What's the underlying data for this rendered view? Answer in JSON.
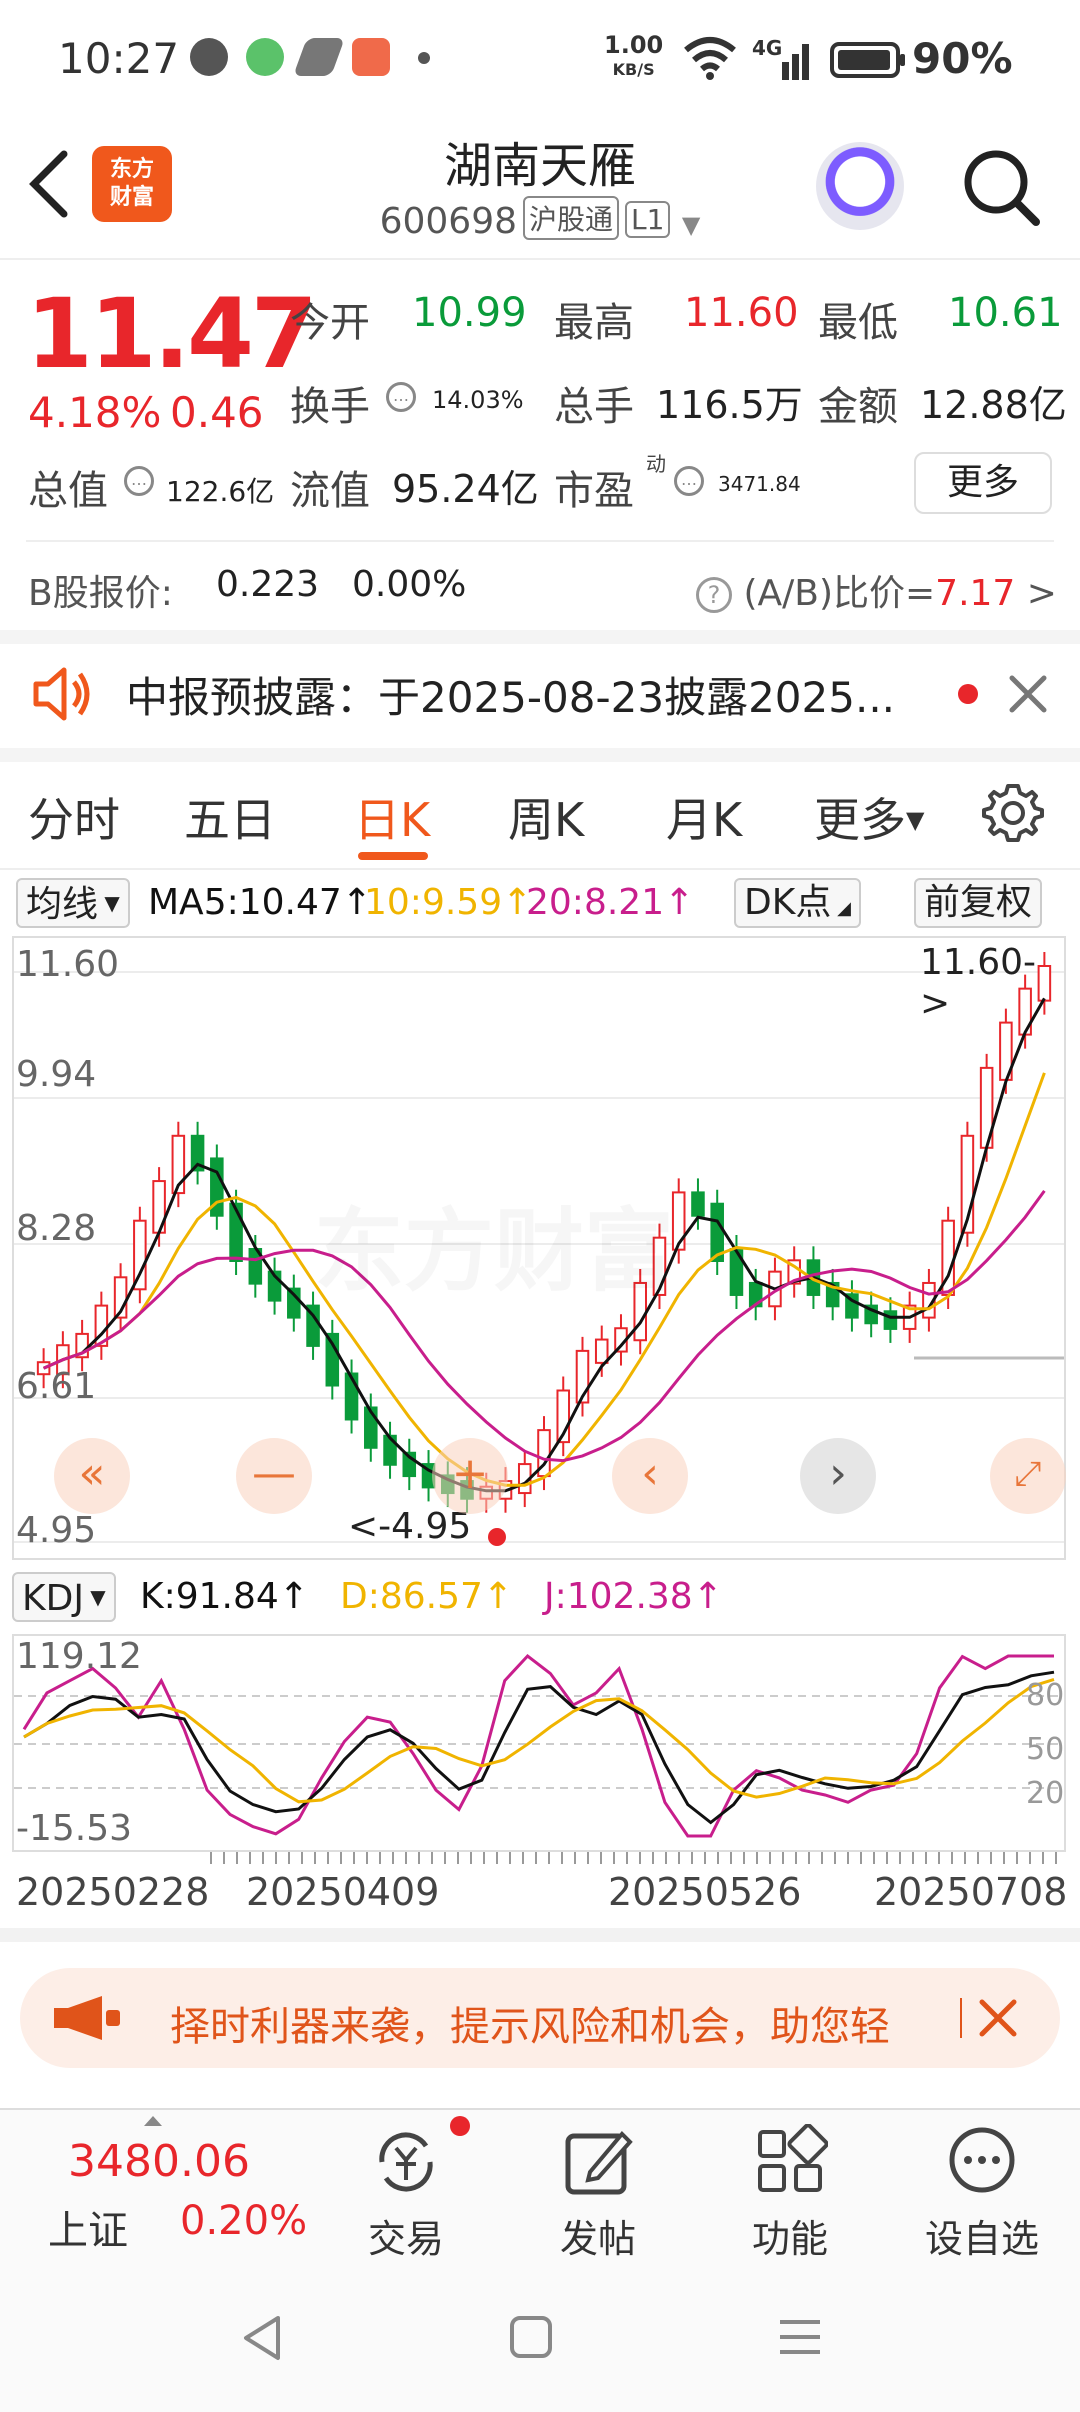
{
  "status_bar": {
    "time": "10:27",
    "net_speed_value": "1.00",
    "net_speed_unit": "KB/S",
    "network": "4G",
    "battery": "90%"
  },
  "header": {
    "logo_text": "东方财富",
    "stock_name": "湖南天雁",
    "stock_code": "600698",
    "tag1": "沪股通",
    "tag2": "L1"
  },
  "quote": {
    "price": "11.47",
    "change_pct": "4.18%",
    "change_amt": "0.46",
    "open_label": "今开",
    "open": "10.99",
    "high_label": "最高",
    "high": "11.60",
    "low_label": "最低",
    "low": "10.61",
    "turnover_label": "换手",
    "turnover": "14.03%",
    "volume_label": "总手",
    "volume": "116.5万",
    "amount_label": "金额",
    "amount": "12.88亿",
    "mktcap_label": "总值",
    "mktcap": "122.6亿",
    "float_label": "流值",
    "float": "95.24亿",
    "pe_label": "市盈",
    "pe_sup": "动",
    "pe": "3471.84",
    "more": "更多"
  },
  "b_share": {
    "label": "B股报价:",
    "price": "0.223",
    "pct": "0.00%",
    "ratio_label": "(A/B)比价=",
    "ratio": "7.17",
    "arrow": ">"
  },
  "notice": {
    "text": "中报预披露：于2025-08-23披露2025..."
  },
  "tabs": [
    "分时",
    "五日",
    "日K",
    "周K",
    "月K",
    "更多"
  ],
  "ma": {
    "dropdown": "均线",
    "ma5": "MA5:10.47↑",
    "ma10": "10:9.59↑",
    "ma20": "20:8.21↑",
    "dk": "DK点",
    "adjust": "前复权"
  },
  "chart": {
    "y_labels": [
      "11.60",
      "9.94",
      "8.28",
      "6.61",
      "4.95"
    ],
    "max_marker": "11.60->",
    "min_marker": "<-4.95",
    "watermark": "东方财富"
  },
  "kdj": {
    "dropdown": "KDJ",
    "k": "K:91.84↑",
    "d": "D:86.57↑",
    "j": "J:102.38↑",
    "y_top": "119.12",
    "y_bottom": "-15.53",
    "lvl80": "80",
    "lvl50": "50",
    "lvl20": "20"
  },
  "dates": [
    "20250228",
    "20250409",
    "20250526",
    "20250708"
  ],
  "banner": {
    "text": "择时利器来袭，提示风险和机会，助您轻"
  },
  "bottom_nav": {
    "index_value": "3480.06",
    "index_name": "上证",
    "index_pct": "0.20%",
    "trade": "交易",
    "post": "发帖",
    "function": "功能",
    "watchlist": "设自选"
  },
  "colors": {
    "brand": "#f0581c",
    "up": "#e8262b",
    "down": "#0a9b3a",
    "ma5": "#111111",
    "ma10": "#f0b400",
    "ma20": "#c81e8c"
  }
}
